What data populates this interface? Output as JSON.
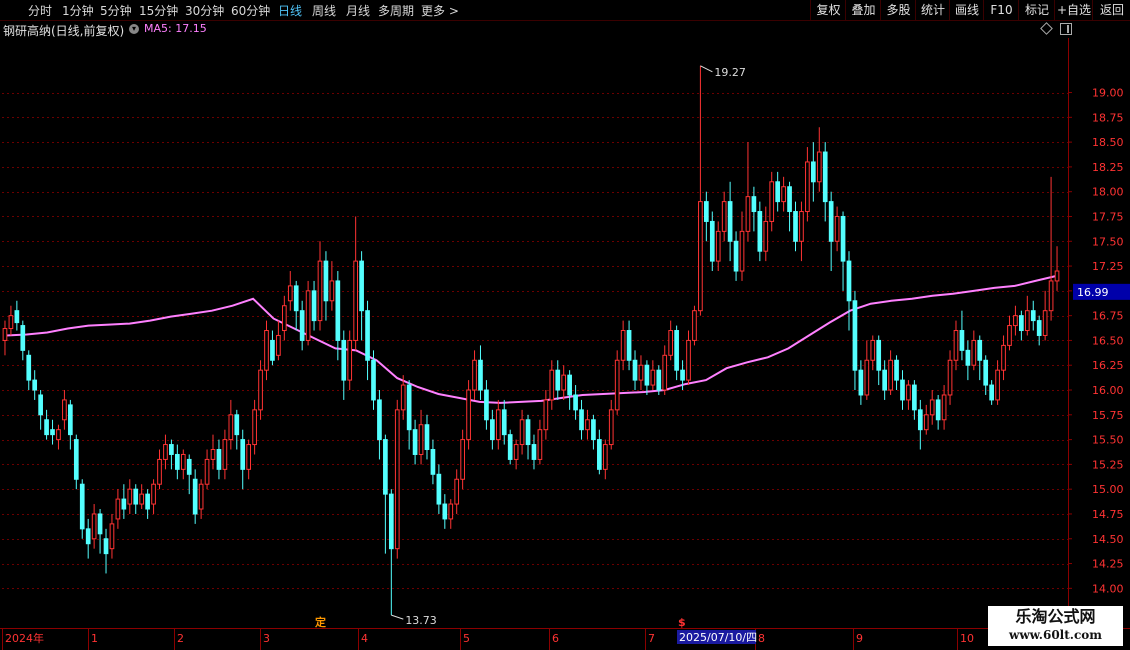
{
  "toolbar": {
    "periods": [
      "分时",
      "1分钟",
      "5分钟",
      "15分钟",
      "30分钟",
      "60分钟",
      "日线",
      "周线",
      "月线",
      "多周期",
      "更多 >"
    ],
    "active_period": "日线",
    "right_buttons": [
      "复权",
      "叠加",
      "多股",
      "统计",
      "画线",
      "F10",
      "标记",
      "+自选",
      "返回"
    ]
  },
  "info": {
    "stock_name": "钢研高纳(日线,前复权)",
    "ma_label": "MA5: 17.15"
  },
  "colors": {
    "up": "#ff3333",
    "down": "#54ffff",
    "ma": "#ff80ff",
    "grid": "#6b0000",
    "axis_text": "#ff3333",
    "price_tag_bg": "#0000aa"
  },
  "chart_data": {
    "type": "candlestick",
    "ylim": [
      13.6,
      19.55
    ],
    "y_ticks": [
      "14.00",
      "14.25",
      "14.50",
      "14.75",
      "15.00",
      "15.25",
      "15.50",
      "15.75",
      "16.00",
      "16.25",
      "16.50",
      "16.75",
      "17.00",
      "17.25",
      "17.50",
      "17.75",
      "18.00",
      "18.25",
      "18.50",
      "18.75",
      "19.00"
    ],
    "current_price": "16.99",
    "high_label": "19.27",
    "low_label": "13.73",
    "x_labels": [
      "2024年",
      "1",
      "2",
      "3",
      "4",
      "5",
      "6",
      "7",
      "8",
      "9",
      "10"
    ],
    "date_cursor": "2025/07/10/四",
    "event_markers": [
      "定",
      "$"
    ],
    "ma_points": [
      16.55,
      16.56,
      16.58,
      16.62,
      16.65,
      16.66,
      16.67,
      16.7,
      16.74,
      16.77,
      16.8,
      16.85,
      16.92,
      16.72,
      16.62,
      16.52,
      16.42,
      16.4,
      16.3,
      16.12,
      16.03,
      15.96,
      15.92,
      15.88,
      15.87,
      15.88,
      15.89,
      15.92,
      15.95,
      15.96,
      15.97,
      15.98,
      16.0,
      16.06,
      16.1,
      16.22,
      16.28,
      16.33,
      16.42,
      16.55,
      16.68,
      16.8,
      16.87,
      16.9,
      16.92,
      16.95,
      16.97,
      17.0,
      17.03,
      17.05,
      17.1,
      17.15
    ],
    "candles": [
      [
        16.5,
        16.62,
        16.7,
        16.35
      ],
      [
        16.62,
        16.75,
        16.85,
        16.55
      ],
      [
        16.8,
        16.68,
        16.9,
        16.6
      ],
      [
        16.65,
        16.4,
        16.7,
        16.3
      ],
      [
        16.35,
        16.1,
        16.4,
        16.0
      ],
      [
        16.1,
        16.0,
        16.2,
        15.9
      ],
      [
        15.95,
        15.75,
        16.0,
        15.6
      ],
      [
        15.7,
        15.55,
        15.8,
        15.5
      ],
      [
        15.6,
        15.55,
        15.7,
        15.45
      ],
      [
        15.5,
        15.6,
        15.65,
        15.4
      ],
      [
        15.7,
        15.9,
        16.0,
        15.6
      ],
      [
        15.85,
        15.55,
        15.9,
        15.4
      ],
      [
        15.5,
        15.1,
        15.55,
        15.0
      ],
      [
        15.05,
        14.6,
        15.1,
        14.5
      ],
      [
        14.6,
        14.45,
        14.7,
        14.3
      ],
      [
        14.5,
        14.75,
        14.85,
        14.4
      ],
      [
        14.75,
        14.55,
        14.8,
        14.35
      ],
      [
        14.5,
        14.35,
        14.6,
        14.15
      ],
      [
        14.4,
        14.65,
        14.75,
        14.3
      ],
      [
        14.7,
        14.9,
        15.0,
        14.6
      ],
      [
        14.9,
        14.8,
        15.05,
        14.7
      ],
      [
        14.85,
        15.0,
        15.1,
        14.75
      ],
      [
        15.0,
        14.85,
        15.05,
        14.75
      ],
      [
        14.85,
        14.95,
        15.05,
        14.8
      ],
      [
        14.95,
        14.8,
        15.0,
        14.7
      ],
      [
        14.85,
        15.05,
        15.1,
        14.75
      ],
      [
        15.05,
        15.3,
        15.4,
        15.0
      ],
      [
        15.3,
        15.45,
        15.55,
        15.2
      ],
      [
        15.45,
        15.35,
        15.5,
        15.2
      ],
      [
        15.35,
        15.2,
        15.45,
        15.1
      ],
      [
        15.2,
        15.35,
        15.4,
        15.1
      ],
      [
        15.3,
        15.15,
        15.35,
        14.95
      ],
      [
        15.1,
        14.75,
        15.2,
        14.65
      ],
      [
        14.8,
        15.05,
        15.1,
        14.7
      ],
      [
        15.05,
        15.3,
        15.4,
        15.0
      ],
      [
        15.3,
        15.4,
        15.55,
        15.2
      ],
      [
        15.4,
        15.2,
        15.5,
        15.1
      ],
      [
        15.2,
        15.5,
        15.6,
        15.1
      ],
      [
        15.5,
        15.75,
        15.9,
        15.4
      ],
      [
        15.75,
        15.55,
        15.8,
        15.4
      ],
      [
        15.5,
        15.2,
        15.6,
        15.0
      ],
      [
        15.2,
        15.45,
        15.5,
        15.1
      ],
      [
        15.45,
        15.8,
        15.9,
        15.35
      ],
      [
        15.8,
        16.2,
        16.3,
        15.7
      ],
      [
        16.2,
        16.6,
        16.7,
        16.1
      ],
      [
        16.5,
        16.3,
        16.6,
        16.25
      ],
      [
        16.35,
        16.55,
        16.7,
        16.3
      ],
      [
        16.6,
        16.85,
        16.95,
        16.5
      ],
      [
        16.9,
        17.05,
        17.2,
        16.8
      ],
      [
        17.05,
        16.8,
        17.1,
        16.6
      ],
      [
        16.8,
        16.5,
        16.9,
        16.4
      ],
      [
        16.5,
        17.0,
        17.1,
        16.45
      ],
      [
        17.0,
        16.7,
        17.1,
        16.6
      ],
      [
        16.7,
        17.3,
        17.5,
        16.6
      ],
      [
        17.3,
        16.9,
        17.4,
        16.7
      ],
      [
        16.9,
        17.1,
        17.3,
        16.8
      ],
      [
        17.1,
        16.5,
        17.2,
        16.3
      ],
      [
        16.5,
        16.1,
        16.6,
        15.9
      ],
      [
        16.1,
        16.5,
        16.6,
        16.0
      ],
      [
        16.5,
        17.3,
        17.75,
        16.4
      ],
      [
        17.3,
        16.8,
        17.4,
        16.5
      ],
      [
        16.8,
        16.3,
        16.9,
        16.1
      ],
      [
        16.3,
        15.9,
        16.4,
        15.8
      ],
      [
        15.9,
        15.5,
        16.0,
        15.3
      ],
      [
        15.5,
        14.95,
        15.55,
        14.35
      ],
      [
        14.95,
        14.4,
        15.0,
        13.73
      ],
      [
        14.4,
        15.8,
        15.9,
        14.3
      ],
      [
        15.8,
        16.05,
        16.15,
        15.7
      ],
      [
        16.05,
        15.6,
        16.1,
        15.4
      ],
      [
        15.6,
        15.35,
        15.7,
        15.25
      ],
      [
        15.35,
        15.65,
        15.8,
        15.25
      ],
      [
        15.65,
        15.4,
        15.75,
        15.3
      ],
      [
        15.4,
        15.15,
        15.5,
        15.05
      ],
      [
        15.15,
        14.85,
        15.25,
        14.75
      ],
      [
        14.85,
        14.7,
        14.95,
        14.6
      ],
      [
        14.7,
        14.85,
        14.9,
        14.6
      ],
      [
        14.85,
        15.1,
        15.2,
        14.75
      ],
      [
        15.1,
        15.5,
        15.6,
        15.0
      ],
      [
        15.5,
        16.0,
        16.1,
        15.4
      ],
      [
        16.0,
        16.3,
        16.4,
        15.9
      ],
      [
        16.3,
        16.0,
        16.45,
        15.9
      ],
      [
        16.0,
        15.7,
        16.1,
        15.6
      ],
      [
        15.7,
        15.5,
        15.8,
        15.4
      ],
      [
        15.5,
        15.8,
        15.9,
        15.4
      ],
      [
        15.8,
        15.55,
        15.9,
        15.45
      ],
      [
        15.55,
        15.3,
        15.6,
        15.25
      ],
      [
        15.3,
        15.45,
        15.5,
        15.2
      ],
      [
        15.45,
        15.7,
        15.8,
        15.35
      ],
      [
        15.7,
        15.45,
        15.75,
        15.3
      ],
      [
        15.45,
        15.3,
        15.55,
        15.2
      ],
      [
        15.3,
        15.6,
        15.7,
        15.25
      ],
      [
        15.6,
        15.9,
        16.0,
        15.5
      ],
      [
        15.9,
        16.2,
        16.3,
        15.8
      ],
      [
        16.2,
        16.0,
        16.3,
        15.9
      ],
      [
        16.0,
        16.15,
        16.25,
        15.9
      ],
      [
        16.15,
        15.95,
        16.2,
        15.8
      ],
      [
        15.95,
        15.8,
        16.05,
        15.7
      ],
      [
        15.8,
        15.6,
        15.9,
        15.5
      ],
      [
        15.6,
        15.7,
        15.8,
        15.5
      ],
      [
        15.7,
        15.5,
        15.75,
        15.4
      ],
      [
        15.5,
        15.2,
        15.6,
        15.15
      ],
      [
        15.2,
        15.45,
        15.5,
        15.1
      ],
      [
        15.45,
        15.8,
        15.9,
        15.4
      ],
      [
        15.8,
        16.3,
        16.4,
        15.75
      ],
      [
        16.3,
        16.6,
        16.7,
        16.2
      ],
      [
        16.6,
        16.3,
        16.7,
        16.2
      ],
      [
        16.3,
        16.1,
        16.4,
        16.0
      ],
      [
        16.1,
        16.25,
        16.35,
        16.0
      ],
      [
        16.25,
        16.05,
        16.3,
        15.95
      ],
      [
        16.05,
        16.2,
        16.3,
        16.0
      ],
      [
        16.2,
        16.0,
        16.25,
        15.95
      ],
      [
        16.0,
        16.35,
        16.45,
        15.95
      ],
      [
        16.35,
        16.6,
        16.7,
        16.3
      ],
      [
        16.6,
        16.2,
        16.65,
        16.1
      ],
      [
        16.2,
        16.1,
        16.3,
        16.0
      ],
      [
        16.1,
        16.5,
        16.6,
        16.05
      ],
      [
        16.5,
        16.8,
        16.85,
        16.45
      ],
      [
        16.8,
        17.9,
        19.27,
        16.75
      ],
      [
        17.9,
        17.7,
        18.0,
        17.5
      ],
      [
        17.7,
        17.3,
        17.8,
        17.2
      ],
      [
        17.3,
        17.6,
        17.7,
        17.2
      ],
      [
        17.6,
        17.9,
        18.0,
        17.5
      ],
      [
        17.9,
        17.5,
        18.1,
        17.3
      ],
      [
        17.5,
        17.2,
        17.6,
        17.1
      ],
      [
        17.2,
        17.6,
        17.8,
        17.1
      ],
      [
        17.6,
        17.95,
        18.5,
        17.5
      ],
      [
        17.95,
        17.8,
        18.05,
        17.6
      ],
      [
        17.8,
        17.4,
        17.9,
        17.3
      ],
      [
        17.4,
        17.7,
        17.85,
        17.3
      ],
      [
        17.7,
        18.1,
        18.2,
        17.6
      ],
      [
        18.1,
        17.9,
        18.2,
        17.8
      ],
      [
        17.9,
        18.05,
        18.15,
        17.8
      ],
      [
        18.05,
        17.8,
        18.1,
        17.6
      ],
      [
        17.8,
        17.5,
        17.9,
        17.4
      ],
      [
        17.5,
        17.8,
        17.9,
        17.3
      ],
      [
        17.8,
        18.3,
        18.45,
        17.7
      ],
      [
        18.3,
        18.1,
        18.5,
        17.9
      ],
      [
        18.1,
        18.4,
        18.65,
        18.0
      ],
      [
        18.4,
        17.9,
        18.5,
        17.7
      ],
      [
        17.9,
        17.5,
        18.0,
        17.2
      ],
      [
        17.5,
        17.75,
        17.85,
        17.4
      ],
      [
        17.75,
        17.3,
        17.8,
        17.0
      ],
      [
        17.3,
        16.9,
        17.4,
        16.6
      ],
      [
        16.9,
        16.2,
        17.0,
        16.0
      ],
      [
        16.2,
        15.95,
        16.3,
        15.85
      ],
      [
        15.95,
        16.3,
        16.5,
        15.9
      ],
      [
        16.3,
        16.5,
        16.55,
        16.2
      ],
      [
        16.5,
        16.2,
        16.55,
        16.05
      ],
      [
        16.2,
        16.0,
        16.3,
        15.9
      ],
      [
        16.0,
        16.3,
        16.4,
        15.95
      ],
      [
        16.3,
        16.1,
        16.35,
        16.0
      ],
      [
        16.1,
        15.9,
        16.2,
        15.8
      ],
      [
        15.9,
        16.05,
        16.1,
        15.8
      ],
      [
        16.05,
        15.8,
        16.1,
        15.7
      ],
      [
        15.8,
        15.6,
        15.9,
        15.4
      ],
      [
        15.6,
        15.75,
        15.85,
        15.55
      ],
      [
        15.75,
        15.9,
        16.0,
        15.65
      ],
      [
        15.9,
        15.7,
        15.95,
        15.6
      ],
      [
        15.7,
        15.95,
        16.05,
        15.6
      ],
      [
        15.95,
        16.3,
        16.4,
        15.85
      ],
      [
        16.3,
        16.6,
        16.7,
        16.2
      ],
      [
        16.6,
        16.4,
        16.8,
        16.3
      ],
      [
        16.4,
        16.25,
        16.5,
        16.1
      ],
      [
        16.25,
        16.5,
        16.6,
        16.2
      ],
      [
        16.5,
        16.3,
        16.55,
        16.1
      ],
      [
        16.3,
        16.05,
        16.35,
        15.95
      ],
      [
        16.05,
        15.9,
        16.1,
        15.85
      ],
      [
        15.9,
        16.2,
        16.3,
        15.85
      ],
      [
        16.2,
        16.45,
        16.55,
        16.1
      ],
      [
        16.45,
        16.65,
        16.75,
        16.4
      ],
      [
        16.65,
        16.75,
        16.85,
        16.55
      ],
      [
        16.75,
        16.6,
        16.8,
        16.5
      ],
      [
        16.6,
        16.8,
        16.95,
        16.55
      ],
      [
        16.8,
        16.7,
        16.9,
        16.6
      ],
      [
        16.7,
        16.55,
        16.75,
        16.45
      ],
      [
        16.55,
        16.8,
        17.0,
        16.5
      ],
      [
        16.8,
        17.1,
        18.15,
        16.7
      ],
      [
        17.1,
        17.2,
        17.45,
        17.0
      ]
    ]
  }
}
